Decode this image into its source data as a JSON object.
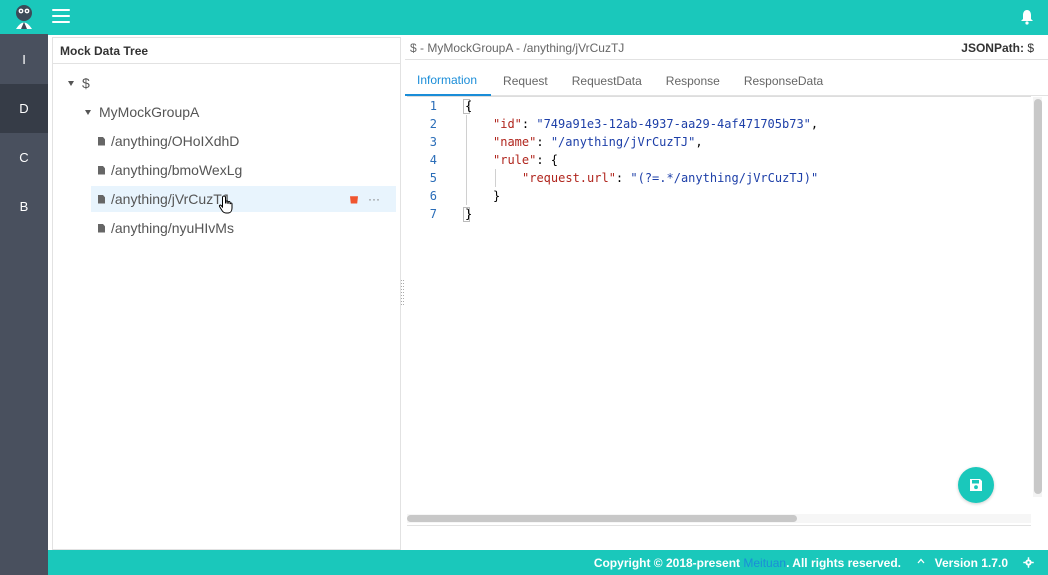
{
  "sidebar": {
    "items": [
      {
        "label": "I",
        "active": false
      },
      {
        "label": "D",
        "active": true
      },
      {
        "label": "C",
        "active": false
      },
      {
        "label": "B",
        "active": false
      }
    ]
  },
  "tree": {
    "title": "Mock Data Tree",
    "root": "$",
    "group": "MyMockGroupA",
    "items": [
      "/anything/OHoIXdhD",
      "/anything/bmoWexLg",
      "/anything/jVrCuzTJ",
      "/anything/nyuHIvMs"
    ],
    "more_label": "···"
  },
  "detail": {
    "path": "$ - MyMockGroupA - /anything/jVrCuzTJ",
    "jsonpath_label": "JSONPath:",
    "jsonpath_value": "$",
    "tabs": [
      "Information",
      "Request",
      "RequestData",
      "Response",
      "ResponseData"
    ],
    "active_tab": "Information"
  },
  "editor": {
    "line_numbers": [
      "1",
      "2",
      "3",
      "4",
      "5",
      "6",
      "7"
    ],
    "lines": {
      "l1": "{",
      "l2_key": "\"id\"",
      "l2_sep": ": ",
      "l2_val": "\"749a91e3-12ab-4937-aa29-4af471705b73\"",
      "l2_end": ",",
      "l3_key": "\"name\"",
      "l3_sep": ": ",
      "l3_val": "\"/anything/jVrCuzTJ\"",
      "l3_end": ",",
      "l4_key": "\"rule\"",
      "l4_sep": ": {",
      "l5_key": "\"request.url\"",
      "l5_sep": ": ",
      "l5_val": "\"(?=.*/anything/jVrCuzTJ)\"",
      "l6": "}",
      "l7": "}"
    }
  },
  "footer": {
    "copyright_prefix": "Copyright © 2018-present ",
    "brand": "Meituan",
    "copyright_suffix": ". All rights reserved.",
    "version": "Version 1.7.0"
  },
  "colors": {
    "accent": "#1ac8bb",
    "sidebar": "#49505e",
    "sidebar_active": "#363c47",
    "link": "#1a8dd8",
    "danger": "#f0552f"
  }
}
